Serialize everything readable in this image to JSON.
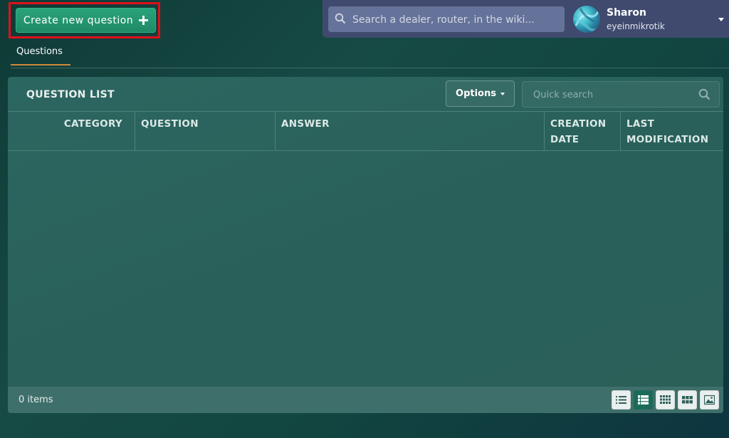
{
  "toolbar": {
    "create_label": "Create new question"
  },
  "header": {
    "search_placeholder": "Search a dealer, router, in the wiki...",
    "user": {
      "name": "Sharon",
      "handle": "eyeinmikrotik"
    }
  },
  "tabs": [
    {
      "label": "Questions",
      "active": true
    }
  ],
  "panel": {
    "title": "QUESTION LIST",
    "options_label": "Options",
    "quick_search_placeholder": "Quick search",
    "columns": [
      "CATEGORY",
      "QUESTION",
      "ANSWER",
      "CREATION DATE",
      "LAST MODIFICATION"
    ],
    "rows": [],
    "footer": {
      "items_count": "0 items"
    },
    "view_modes": [
      {
        "icon": "list-view-icon",
        "active": false
      },
      {
        "icon": "table-view-icon",
        "active": true
      },
      {
        "icon": "grid-small-view-icon",
        "active": false
      },
      {
        "icon": "grid-large-view-icon",
        "active": false
      },
      {
        "icon": "image-view-icon",
        "active": false
      }
    ]
  },
  "colors": {
    "accent": "#1f8a66",
    "highlight": "#e0101a",
    "tab_underline": "#d08a3a",
    "header_bg": "#3f4a6e"
  }
}
